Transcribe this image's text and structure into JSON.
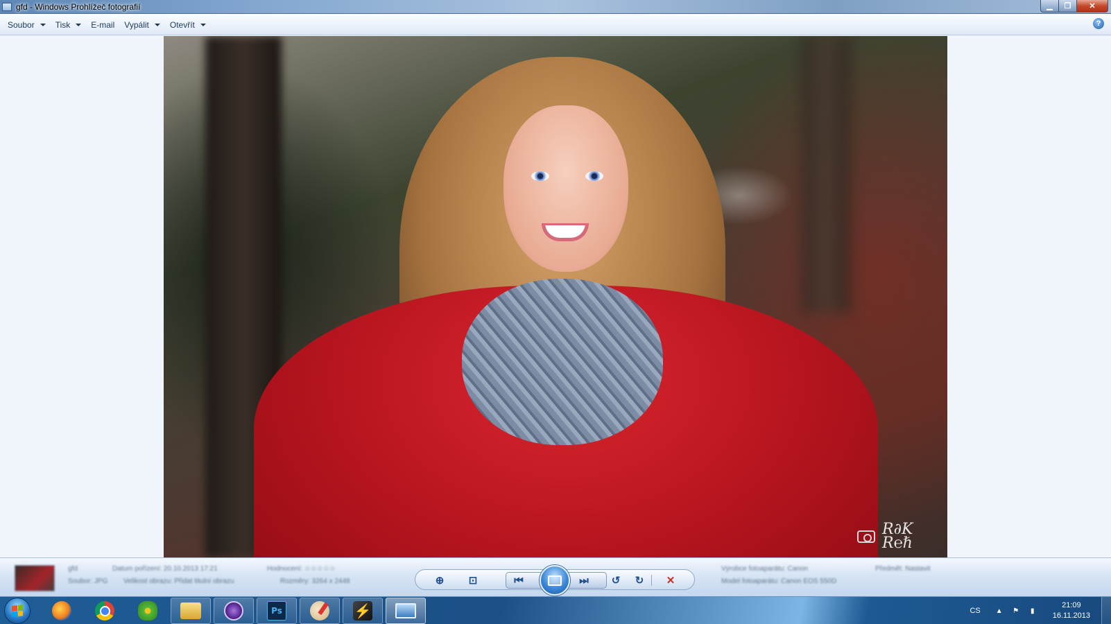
{
  "window": {
    "title": "gfd - Windows Prohlížeč fotografií",
    "controls": {
      "minimize": "▁",
      "maximize": "❐",
      "close": "✕"
    }
  },
  "menu": {
    "items": [
      {
        "label": "Soubor",
        "has_dropdown": true
      },
      {
        "label": "Tisk",
        "has_dropdown": true
      },
      {
        "label": "E-mail",
        "has_dropdown": false
      },
      {
        "label": "Vypálit",
        "has_dropdown": true
      },
      {
        "label": "Otevřít",
        "has_dropdown": true
      }
    ],
    "help_glyph": "?"
  },
  "photo": {
    "watermark_text": "Radek Reichel"
  },
  "info_bar": {
    "file_name": "gfd",
    "meta_lines": [
      "Datum pořízení: 20.10.2013 17:21",
      "Hodnocení: ☆☆☆☆☆",
      "Soubor: JPG",
      "Velikost obrazu: Přidat titulní obrazu",
      "Rozměry: 3264 x 2448",
      "Výrobce fotoaparátu: Canon",
      "Model fotoaparátu: Canon EOS 550D",
      "Předmět: Nastavit"
    ],
    "controls": [
      {
        "name": "zoom",
        "glyph": "⊕"
      },
      {
        "name": "actual-size",
        "glyph": "⊡"
      },
      {
        "name": "previous",
        "glyph": "⏮"
      },
      {
        "name": "slideshow",
        "glyph": ""
      },
      {
        "name": "next",
        "glyph": "⏭"
      },
      {
        "name": "rotate-left",
        "glyph": "↺"
      },
      {
        "name": "rotate-right",
        "glyph": "↻"
      },
      {
        "name": "delete",
        "glyph": "✕"
      }
    ]
  },
  "taskbar": {
    "apps": [
      {
        "name": "firefox",
        "label": ""
      },
      {
        "name": "chrome",
        "label": ""
      },
      {
        "name": "icq",
        "label": ""
      },
      {
        "name": "explorer",
        "label": ""
      },
      {
        "name": "pandion",
        "label": ""
      },
      {
        "name": "photoshop",
        "label": "Ps"
      },
      {
        "name": "paint",
        "label": ""
      },
      {
        "name": "winamp",
        "label": "⚡"
      },
      {
        "name": "photo-viewer",
        "label": ""
      }
    ],
    "tray": {
      "language": "CS",
      "time": "21:09",
      "date": "16.11.2013"
    }
  },
  "colors": {
    "accent": "#3b86d6",
    "close_button": "#c44a2b",
    "delete_icon": "#d22b1f"
  }
}
